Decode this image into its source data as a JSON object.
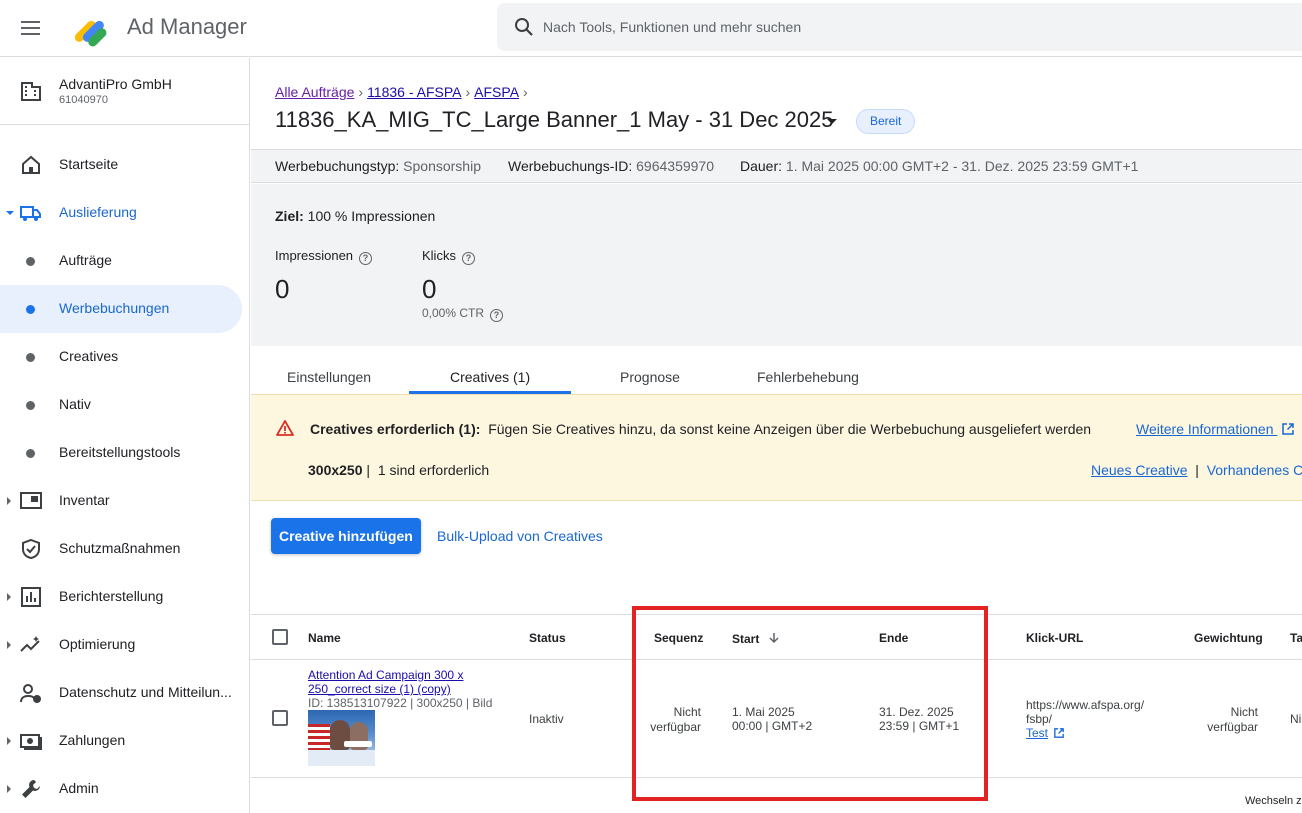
{
  "app": {
    "title": "Ad Manager"
  },
  "search": {
    "placeholder": "Nach Tools, Funktionen und mehr suchen"
  },
  "account": {
    "name": "AdvantiPro GmbH",
    "id": "61040970"
  },
  "sidebar": {
    "items": [
      {
        "label": "Startseite"
      },
      {
        "label": "Auslieferung"
      },
      {
        "label": "Aufträge"
      },
      {
        "label": "Werbebuchungen"
      },
      {
        "label": "Creatives"
      },
      {
        "label": "Nativ"
      },
      {
        "label": "Bereitstellungstools"
      },
      {
        "label": "Inventar"
      },
      {
        "label": "Schutzmaßnahmen"
      },
      {
        "label": "Berichterstellung"
      },
      {
        "label": "Optimierung"
      },
      {
        "label": "Datenschutz und Mitteilun..."
      },
      {
        "label": "Zahlungen"
      },
      {
        "label": "Admin"
      }
    ]
  },
  "breadcrumb": [
    {
      "label": "Alle Aufträge"
    },
    {
      "label": "11836 - AFSPA"
    },
    {
      "label": "AFSPA"
    }
  ],
  "page": {
    "title": "11836_KA_MIG_TC_Large Banner_1 May - 31 Dec 2025",
    "status": "Bereit"
  },
  "meta": {
    "type_label": "Werbebuchungstyp:",
    "type_value": "Sponsorship",
    "id_label": "Werbebuchungs-ID:",
    "id_value": "6964359970",
    "duration_label": "Dauer:",
    "duration_value": "1. Mai 2025 00:00 GMT+2 - 31. Dez. 2025 23:59 GMT+1"
  },
  "stats": {
    "goal_label": "Ziel:",
    "goal_value": "100 % Impressionen",
    "impressions_label": "Impressionen",
    "impressions_value": "0",
    "clicks_label": "Klicks",
    "clicks_value": "0",
    "ctr": "0,00% CTR"
  },
  "tabs": [
    {
      "label": "Einstellungen"
    },
    {
      "label": "Creatives (1)"
    },
    {
      "label": "Prognose"
    },
    {
      "label": "Fehlerbehebung"
    }
  ],
  "warning": {
    "title": "Creatives erforderlich (1):",
    "message": "Fügen Sie Creatives hinzu, da sonst keine Anzeigen über die Werbebuchung ausgeliefert werden",
    "link": "Weitere Informationen",
    "size": "300x250",
    "size_sep": "|",
    "size_note": "1 sind erforderlich",
    "new_creative": "Neues Creative",
    "link_sep": "|",
    "existing_creative": "Vorhandenes Cr"
  },
  "actions": {
    "add_creative": "Creative hinzufügen",
    "bulk_upload": "Bulk-Upload von Creatives"
  },
  "table": {
    "headers": {
      "name": "Name",
      "status": "Status",
      "sequence": "Sequenz",
      "start": "Start",
      "end": "Ende",
      "click_url": "Klick-URL",
      "weighting": "Gewichtung",
      "truncated": "Ta"
    },
    "row": {
      "name_line1": "Attention Ad Campaign 300 x",
      "name_line2": "250_correct size (1) (copy)",
      "meta": "ID: 138513107922 | 300x250 | Bild",
      "status": "Inaktiv",
      "sequence_line1": "Nicht",
      "sequence_line2": "verfügbar",
      "start_line1": "1. Mai 2025",
      "start_line2": "00:00 | GMT+2",
      "end_line1": "31. Dez. 2025",
      "end_line2": "23:59 | GMT+1",
      "url_line1": "https://www.afspa.org/",
      "url_line2": "fsbp/",
      "url_test": "Test",
      "weighting_line1": "Nicht",
      "weighting_line2": "verfügbar",
      "truncated": "Ni"
    }
  },
  "footer": {
    "note": "Wechseln z"
  },
  "colors": {
    "accent": "#1a73e8",
    "highlight": "#e32222",
    "warning_bg": "#fef7e0",
    "active_nav_bg": "#e8f0fe"
  }
}
